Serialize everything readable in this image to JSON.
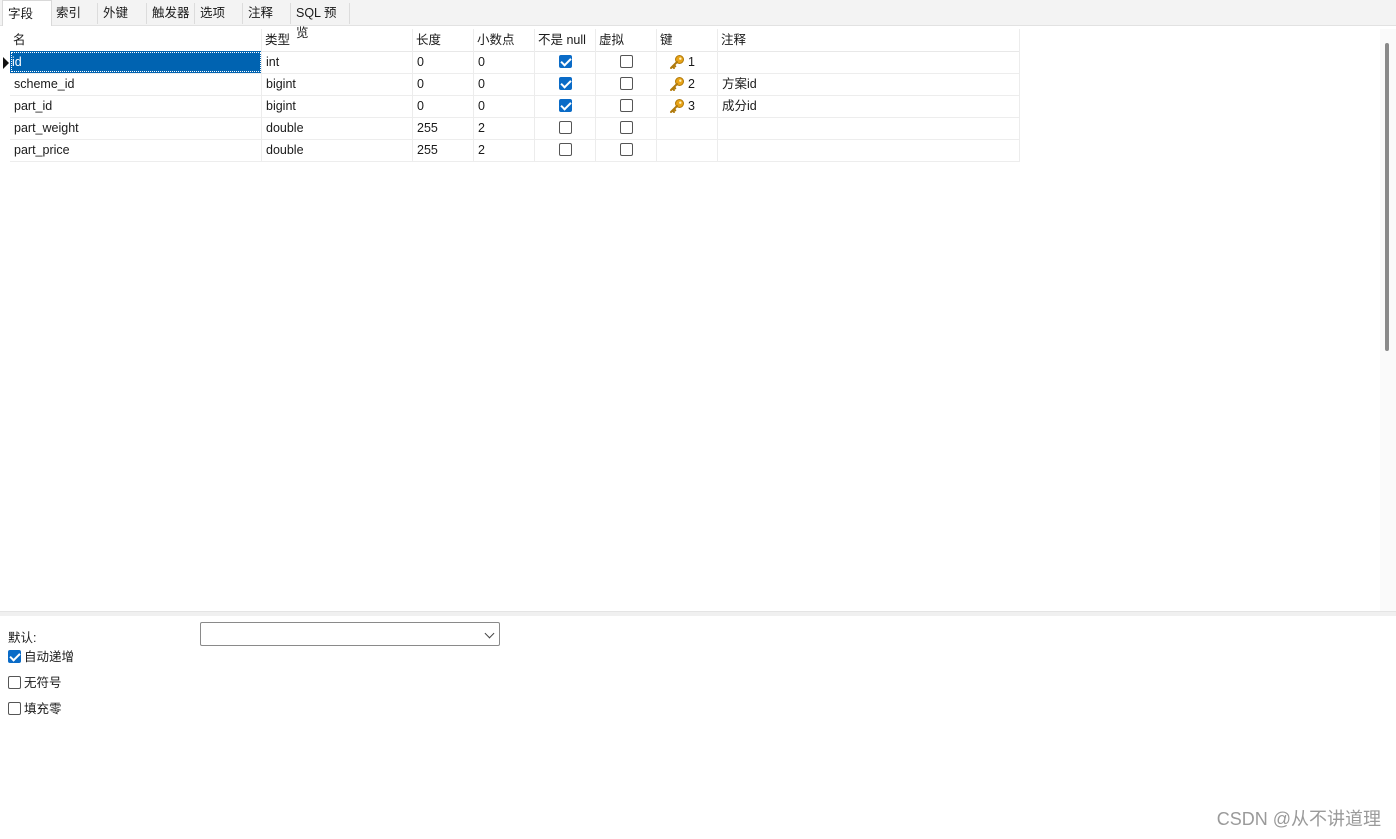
{
  "tabs": [
    {
      "label": "字段",
      "active": true
    },
    {
      "label": "索引"
    },
    {
      "label": "外键"
    },
    {
      "label": "触发器"
    },
    {
      "label": "选项"
    },
    {
      "label": "注释"
    },
    {
      "label": "SQL 预览"
    }
  ],
  "grid": {
    "headers": [
      "名",
      "类型",
      "长度",
      "小数点",
      "不是 null",
      "虚拟",
      "键",
      "注释"
    ],
    "rows": [
      {
        "name": "id",
        "type": "int",
        "length": "0",
        "decimals": "0",
        "not_null": true,
        "virtual": false,
        "key": "1",
        "comment": ""
      },
      {
        "name": "scheme_id",
        "type": "bigint",
        "length": "0",
        "decimals": "0",
        "not_null": true,
        "virtual": false,
        "key": "2",
        "comment": "方案id"
      },
      {
        "name": "part_id",
        "type": "bigint",
        "length": "0",
        "decimals": "0",
        "not_null": true,
        "virtual": false,
        "key": "3",
        "comment": "成分id"
      },
      {
        "name": "part_weight",
        "type": "double",
        "length": "255",
        "decimals": "2",
        "not_null": false,
        "virtual": false,
        "key": "",
        "comment": ""
      },
      {
        "name": "part_price",
        "type": "double",
        "length": "255",
        "decimals": "2",
        "not_null": false,
        "virtual": false,
        "key": "",
        "comment": ""
      }
    ]
  },
  "props": {
    "default_label": "默认:",
    "default_value": "",
    "auto_increment": {
      "label": "自动递增",
      "checked": true
    },
    "unsigned": {
      "label": "无符号",
      "checked": false
    },
    "zerofill": {
      "label": "填充零",
      "checked": false
    }
  },
  "watermark": "CSDN @从不讲道理",
  "colors": {
    "selection": "#0063b1",
    "checkbox": "#0a6bc7",
    "key": "#e8a317"
  }
}
